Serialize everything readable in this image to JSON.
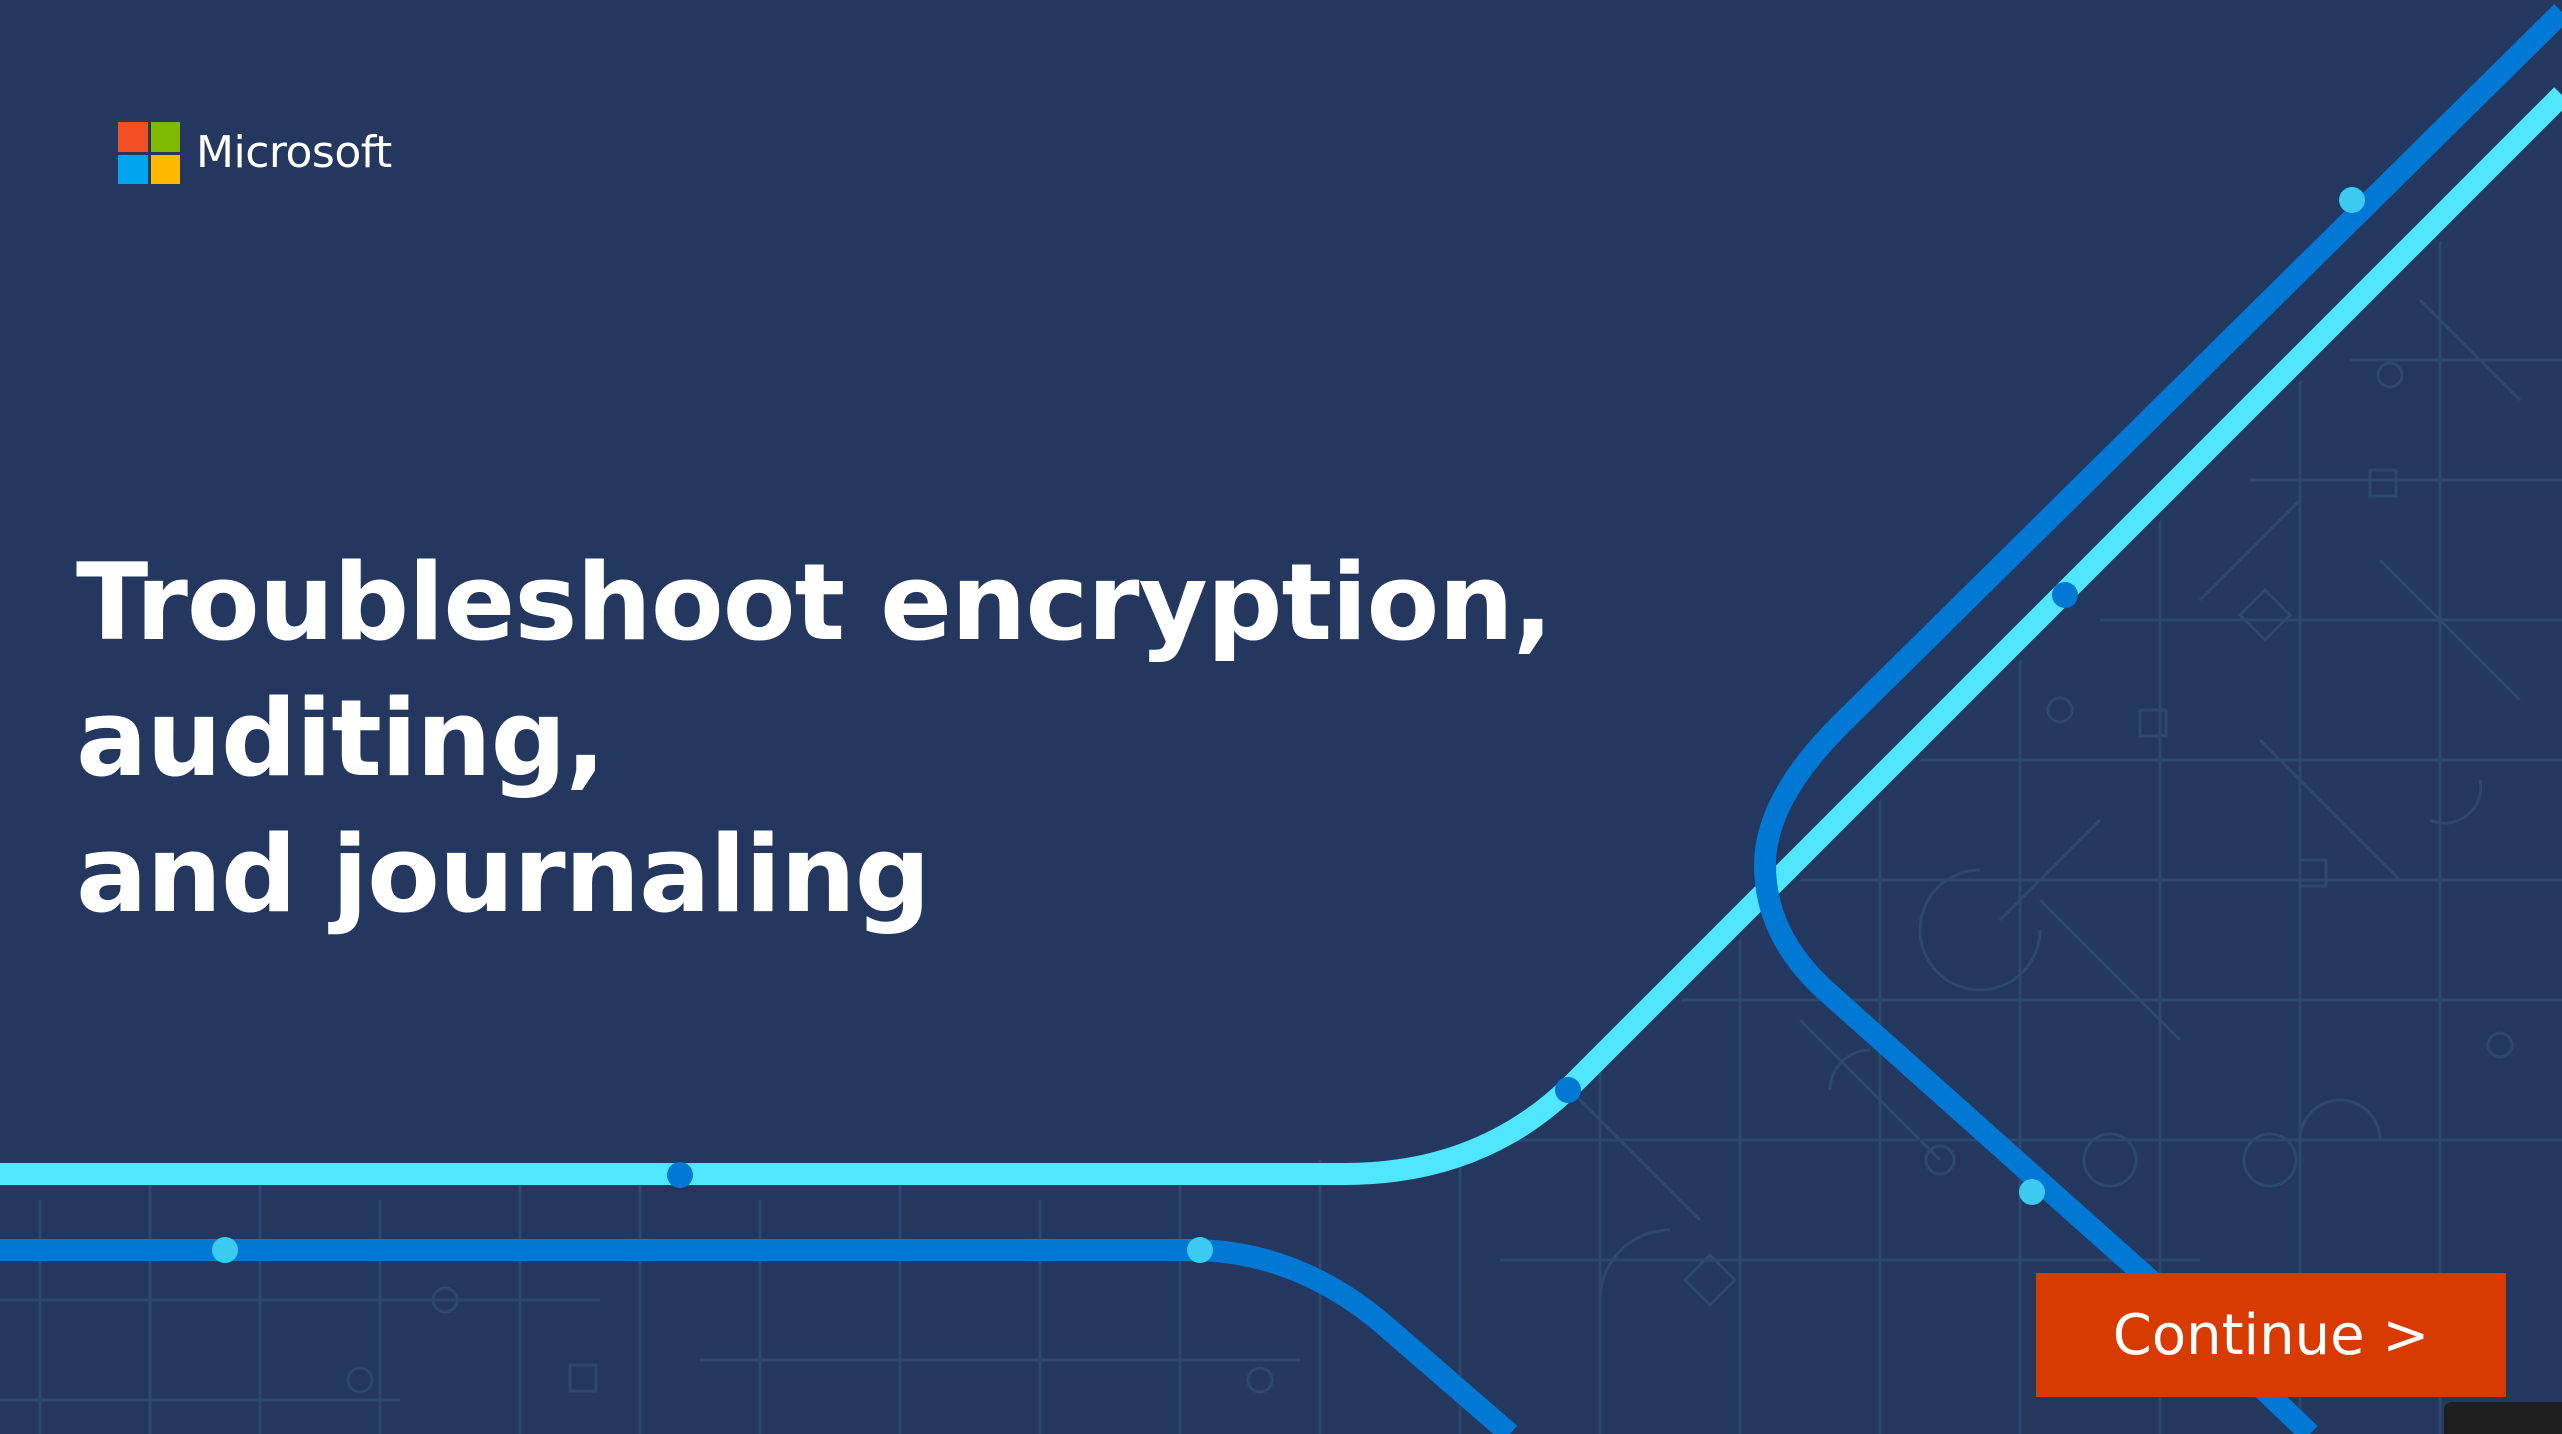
{
  "brand": {
    "name": "Microsoft",
    "logo_colors": [
      "#f25022",
      "#7fba00",
      "#00a4ef",
      "#ffb900"
    ]
  },
  "slide": {
    "title_line1": "Troubleshoot encryption, auditing,",
    "title_line2": "and journaling"
  },
  "actions": {
    "continue_label": "Continue >"
  },
  "colors": {
    "background": "#24375e",
    "line_light": "#50e6ff",
    "line_dark": "#0078d4",
    "button": "#d83b01"
  }
}
